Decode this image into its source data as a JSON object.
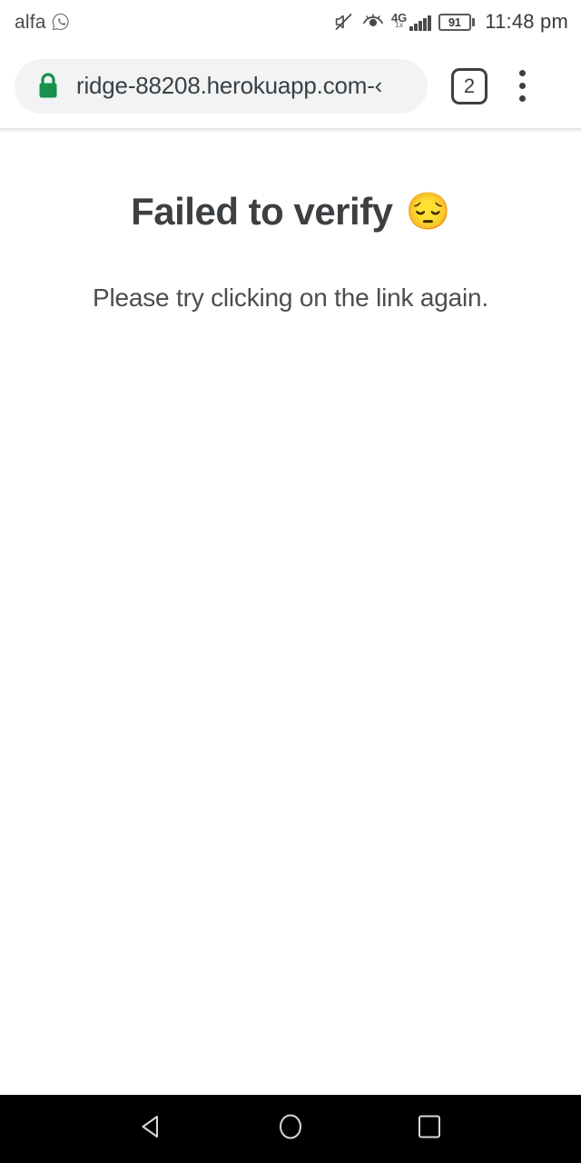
{
  "status_bar": {
    "carrier": "alfa",
    "carrier_app_icon": "whatsapp-icon",
    "mute_icon": "volume-mute-icon",
    "eye_comfort_icon": "eye-icon",
    "network_type": "4G",
    "network_sub": "1x",
    "signal_icon": "signal-bars-icon",
    "battery_level": "91",
    "time": "11:48 pm"
  },
  "browser": {
    "url": "›-ridge-88208.herokuapp.com",
    "security_icon": "lock-icon",
    "tab_count": "2",
    "menu_icon": "overflow-menu-icon"
  },
  "page": {
    "title": "Failed to verify",
    "title_emoji": "😔",
    "subtitle": "Please try clicking on the link again."
  },
  "nav_bar": {
    "back_icon": "back-triangle-icon",
    "home_icon": "home-circle-icon",
    "recents_icon": "recents-square-icon"
  },
  "colors": {
    "lock_green": "#17914d",
    "url_bar_bg": "#f1f3f4",
    "text_dark": "#3c4043",
    "nav_bar_bg": "#000000"
  }
}
